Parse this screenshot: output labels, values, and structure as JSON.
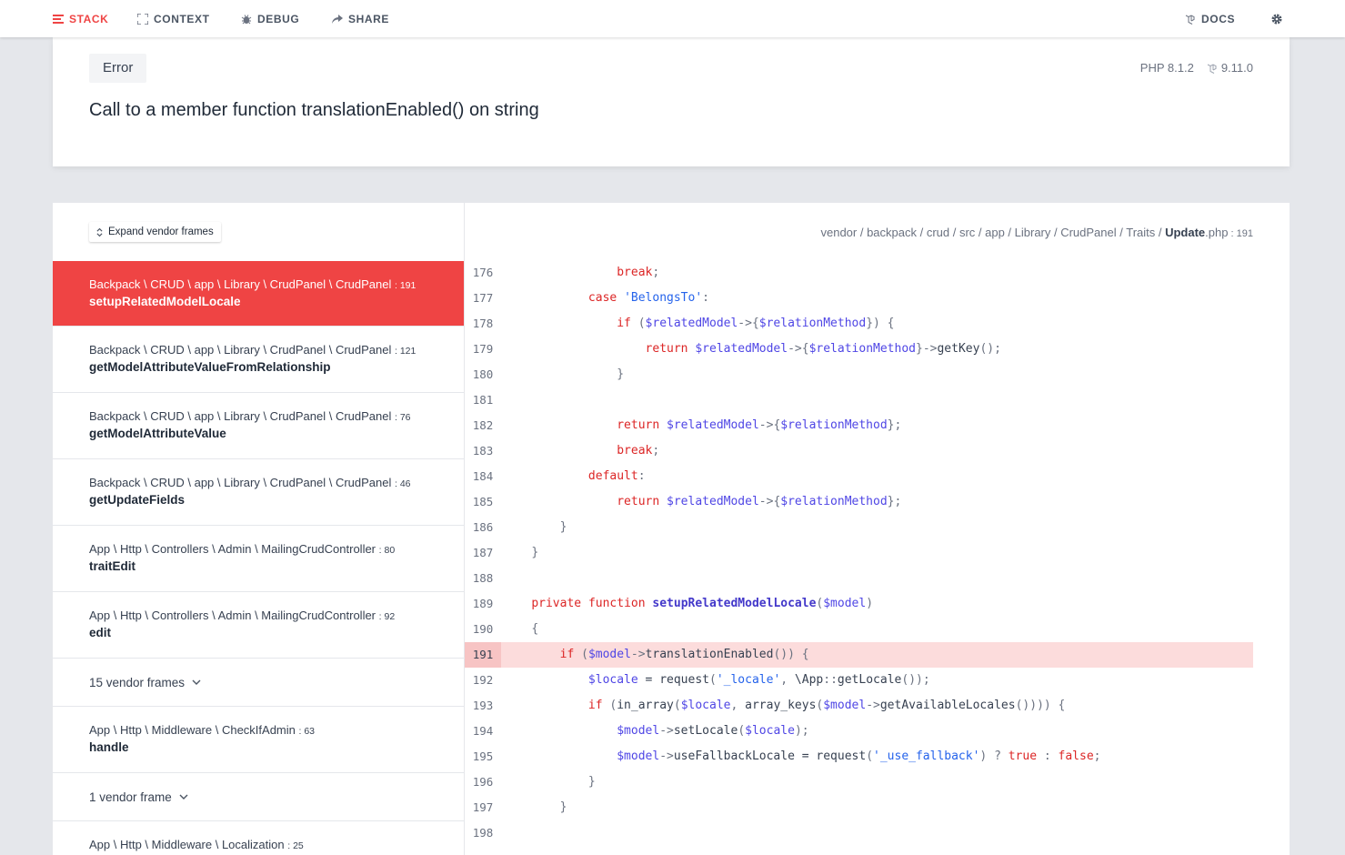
{
  "nav": {
    "stack": "STACK",
    "context": "CONTEXT",
    "debug": "DEBUG",
    "share": "SHARE",
    "docs": "DOCS",
    "accent": "#ef4444"
  },
  "header": {
    "error_type": "Error",
    "php_version": "PHP 8.1.2",
    "laravel_version": "9.11.0",
    "message": "Call to a member function translationEnabled() on string"
  },
  "frames_panel": {
    "expand_label": "Expand vendor frames",
    "frames": [
      {
        "cls": "Backpack \\ CRUD \\ app \\ Library \\ CrudPanel \\ CrudPanel",
        "line": ": 191",
        "fn": "setupRelatedModelLocale"
      },
      {
        "cls": "Backpack \\ CRUD \\ app \\ Library \\ CrudPanel \\ CrudPanel",
        "line": ": 121",
        "fn": "getModelAttributeValueFromRelationship"
      },
      {
        "cls": "Backpack \\ CRUD \\ app \\ Library \\ CrudPanel \\ CrudPanel",
        "line": ": 76",
        "fn": "getModelAttributeValue"
      },
      {
        "cls": "Backpack \\ CRUD \\ app \\ Library \\ CrudPanel \\ CrudPanel",
        "line": ": 46",
        "fn": "getUpdateFields"
      },
      {
        "cls": "App \\ Http \\ Controllers \\ Admin \\ MailingCrudController",
        "line": ": 80",
        "fn": "traitEdit"
      },
      {
        "cls": "App \\ Http \\ Controllers \\ Admin \\ MailingCrudController",
        "line": ": 92",
        "fn": "edit"
      },
      {
        "cls": "App \\ Http \\ Middleware \\ CheckIfAdmin",
        "line": ": 63",
        "fn": "handle"
      },
      {
        "cls": "App \\ Http \\ Middleware \\ Localization",
        "line": ": 25",
        "fn": ""
      }
    ],
    "vendor_groups": [
      "15 vendor frames",
      "1 vendor frame"
    ]
  },
  "code": {
    "path_prefix": "vendor / backpack / crud / src / app / Library / CrudPanel / Traits / ",
    "file": "Update",
    "ext": ".php",
    "line": " : 191",
    "lines": [
      {
        "n": "176",
        "t": "                break;"
      },
      {
        "n": "177",
        "t": "            case 'BelongsTo':"
      },
      {
        "n": "178",
        "t": "                if ($relatedModel->{$relationMethod}) {"
      },
      {
        "n": "179",
        "t": "                    return $relatedModel->{$relationMethod}->getKey();"
      },
      {
        "n": "180",
        "t": "                }"
      },
      {
        "n": "181",
        "t": ""
      },
      {
        "n": "182",
        "t": "                return $relatedModel->{$relationMethod};"
      },
      {
        "n": "183",
        "t": "                break;"
      },
      {
        "n": "184",
        "t": "            default:"
      },
      {
        "n": "185",
        "t": "                return $relatedModel->{$relationMethod};"
      },
      {
        "n": "186",
        "t": "        }"
      },
      {
        "n": "187",
        "t": "    }"
      },
      {
        "n": "188",
        "t": ""
      },
      {
        "n": "189",
        "t": "    private function setupRelatedModelLocale($model)"
      },
      {
        "n": "190",
        "t": "    {"
      },
      {
        "n": "191",
        "t": "        if ($model->translationEnabled()) {"
      },
      {
        "n": "192",
        "t": "            $locale = request('_locale', \\App::getLocale());"
      },
      {
        "n": "193",
        "t": "            if (in_array($locale, array_keys($model->getAvailableLocales()))) {"
      },
      {
        "n": "194",
        "t": "                $model->setLocale($locale);"
      },
      {
        "n": "195",
        "t": "                $model->useFallbackLocale = request('_use_fallback') ? true : false;"
      },
      {
        "n": "196",
        "t": "            }"
      },
      {
        "n": "197",
        "t": "        }"
      },
      {
        "n": "198",
        "t": ""
      }
    ],
    "highlight_line": "191"
  }
}
